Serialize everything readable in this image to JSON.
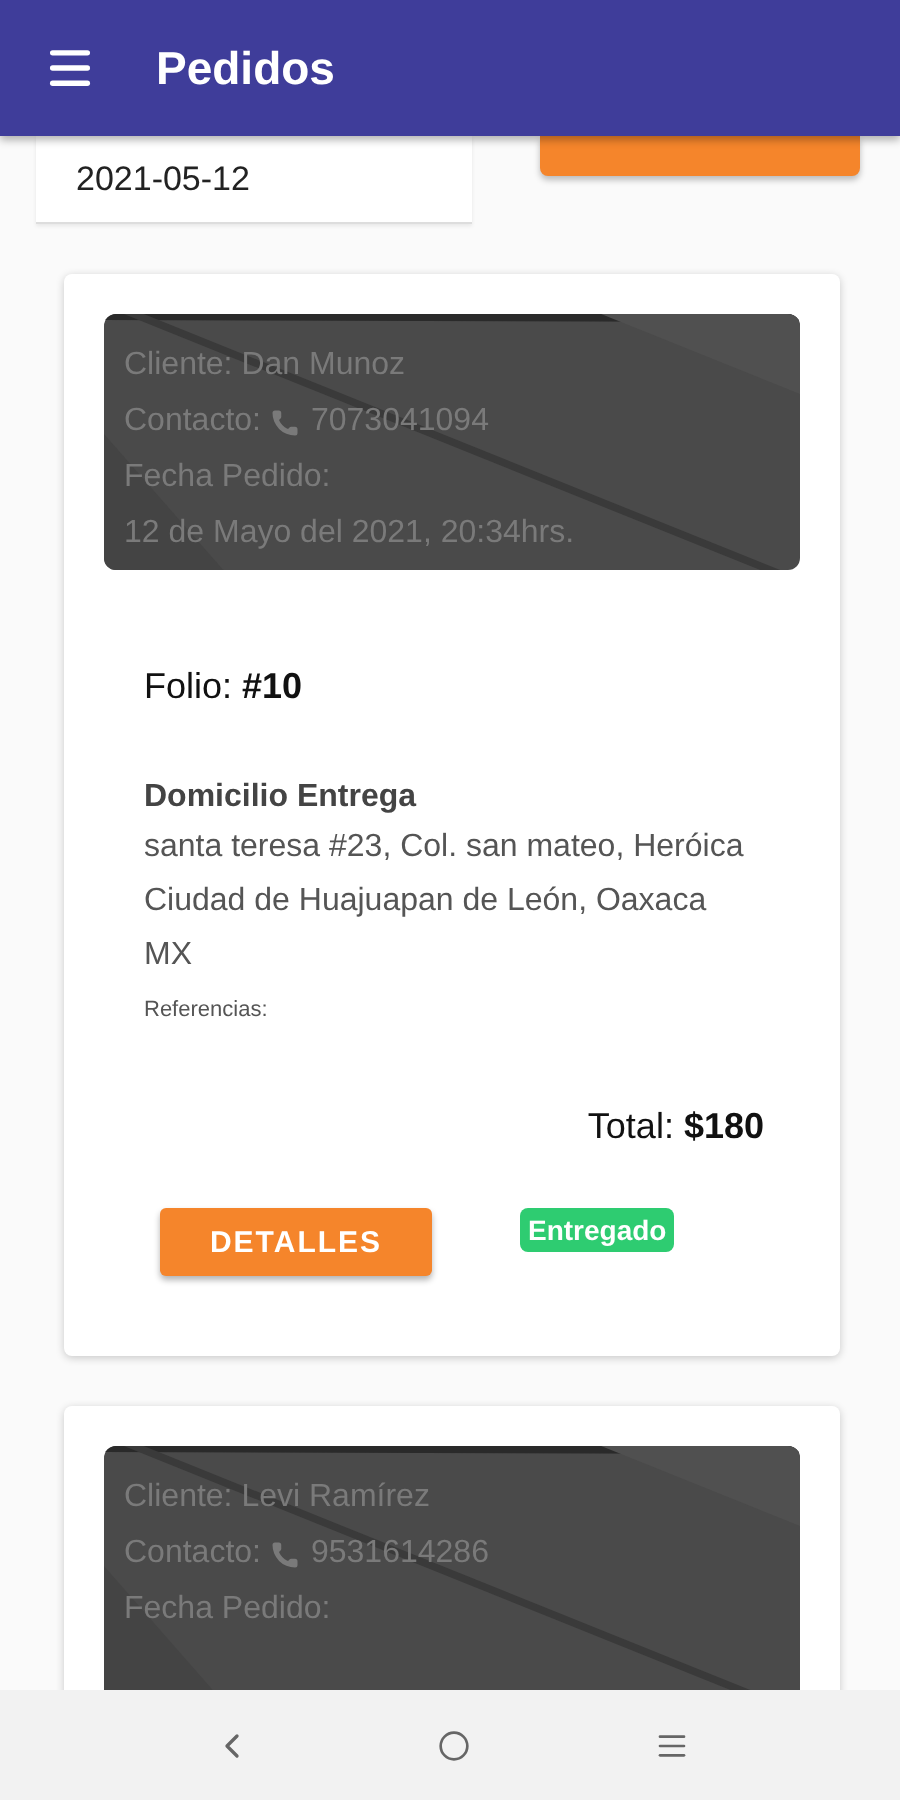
{
  "app_bar": {
    "title": "Pedidos"
  },
  "filter": {
    "date": "2021-05-12"
  },
  "orders": [
    {
      "client": "Cliente: Dan Munoz",
      "contact_label": "Contacto:",
      "phone": "7073041094",
      "date_label": "Fecha Pedido:",
      "date": "12 de Mayo del 2021, 20:34hrs.",
      "folio": "Folio: **#10**",
      "address_title": "Domicilio Entrega",
      "address": "santa teresa #23, Col. san mateo, Heróica Ciudad de Huajuapan de León, Oaxaca MX",
      "references": "Referencias:",
      "total": "Total: **$180**",
      "details_button": "DETALLES",
      "status": "Entregado",
      "color": "#2ecc71"
    },
    {
      "client": "Cliente: Levi Ramírez",
      "contact_label": "Contacto:",
      "phone": "9531614286",
      "date_label": "Fecha Pedido:"
    }
  ]
}
